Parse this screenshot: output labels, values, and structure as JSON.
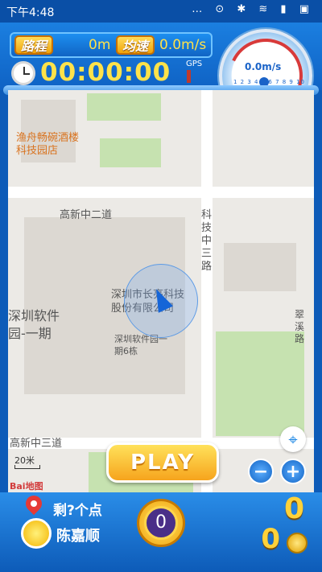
{
  "status_bar": {
    "time": "下午4:48",
    "icons": "… ⊙ ✱ ≋ ▮ ▣"
  },
  "header": {
    "distance_label": "路程",
    "distance_value": "0m",
    "avg_speed_label": "均速",
    "avg_speed_value": "0.0m/s",
    "timer": "00:00:00",
    "gps_label": "GPS",
    "gauge_speed": "0.0m/s",
    "gauge_ticks": "1 2 3 4 5 6 7 8 9 10"
  },
  "map": {
    "labels": {
      "poi_restaurant": "渔舟畅碗酒楼科技园店",
      "road_gaoxin2": "高新中二道",
      "road_keji3": "科技中三路",
      "company": "深圳市长亮科技股份有限公司",
      "software_park": "深圳软件园-一期",
      "building6": "深圳软件园一期6栋",
      "road_gaoxin3": "高新中三道",
      "cuixi_road": "翠溪路"
    },
    "scale_label": "20米",
    "logo": "Bai地图",
    "play_label": "PLAY",
    "zoom_out": "−",
    "zoom_in": "+"
  },
  "bottom": {
    "remaining": "剩?个点",
    "player_name": "陈嘉顺",
    "center_count": "0",
    "score": "0",
    "coins": "0"
  }
}
